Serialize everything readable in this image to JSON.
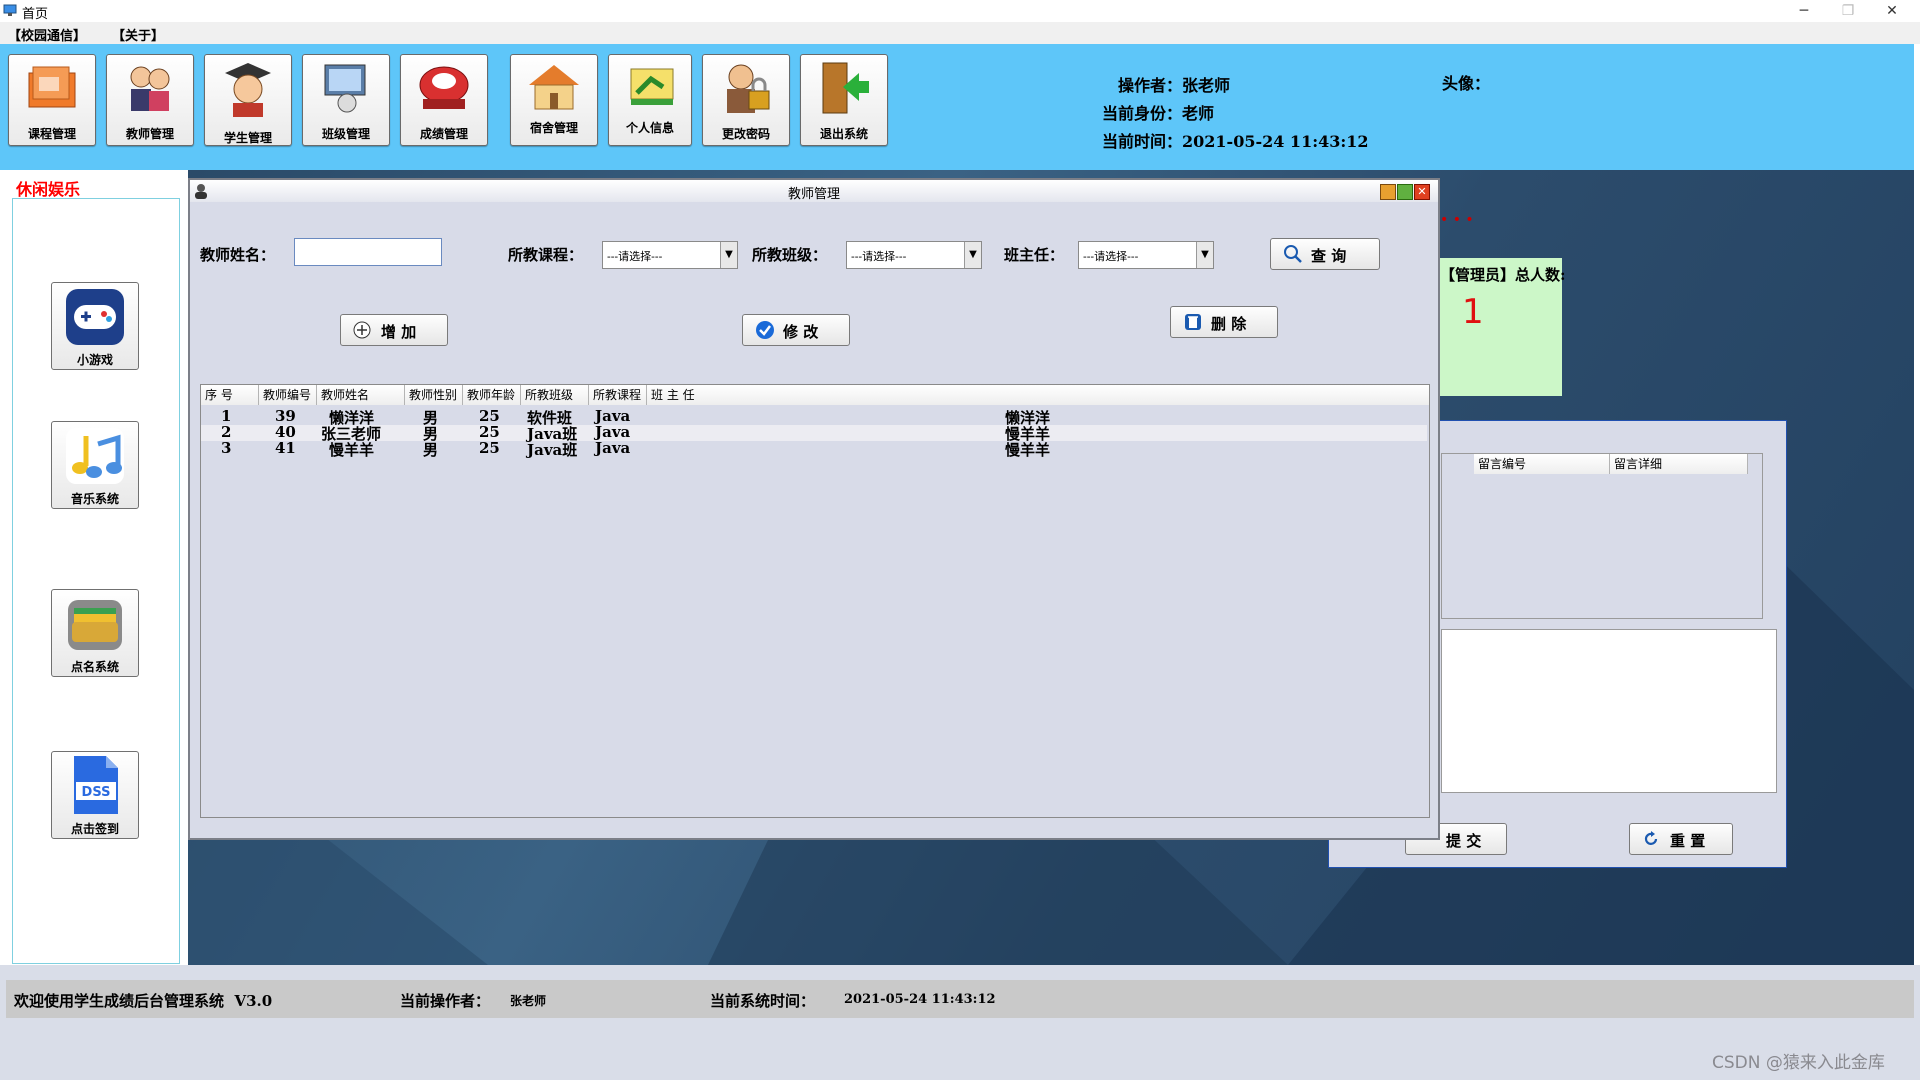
{
  "window": {
    "title": "首页",
    "minimize": "─",
    "restore": "❐",
    "close": "✕"
  },
  "menu": {
    "items": [
      "【校园通信】",
      "【关于】"
    ]
  },
  "toolbar": {
    "buttons": [
      {
        "label": "课程管理",
        "icon": "folder-icon"
      },
      {
        "label": "教师管理",
        "icon": "teachers-icon"
      },
      {
        "label": "学生管理",
        "icon": "graduate-icon"
      },
      {
        "label": "班级管理",
        "icon": "computer-icon"
      },
      {
        "label": "成绩管理",
        "icon": "scale-icon"
      },
      {
        "label": "宿舍管理",
        "icon": "house-icon"
      },
      {
        "label": "个人信息",
        "icon": "profile-icon"
      },
      {
        "label": "更改密码",
        "icon": "lock-icon"
      },
      {
        "label": "退出系统",
        "icon": "exit-door-icon"
      }
    ]
  },
  "info": {
    "operator_label": "操作者：",
    "operator": "张老师",
    "role_label": "当前身份：",
    "role": "老师",
    "time_label": "当前时间：",
    "time": "2021-05-24 11:43:12",
    "avatar_label": "头像："
  },
  "sidebar": {
    "title": "休闲娱乐",
    "items": [
      {
        "label": "小游戏",
        "icon": "gamepad-icon"
      },
      {
        "label": "音乐系统",
        "icon": "music-note-icon"
      },
      {
        "label": "点名系统",
        "icon": "wallet-icon"
      },
      {
        "label": "点击签到",
        "icon": "dss-file-icon"
      }
    ]
  },
  "teacher_window": {
    "title": "教师管理",
    "name_label": "教师姓名：",
    "name_value": "",
    "course_label": "所教课程：",
    "course_value": "---请选择---",
    "class_label": "所教班级：",
    "class_value": "---请选择---",
    "head_label": "班主任：",
    "head_value": "---请选择---",
    "query_label": "查  询",
    "add_label": "增  加",
    "edit_label": "修  改",
    "delete_label": "删  除",
    "table": {
      "headers": [
        "序  号",
        "教师编号",
        "教师姓名",
        "教师性别",
        "教师年龄",
        "所教班级",
        "所教课程",
        "班 主 任"
      ],
      "rows": [
        [
          "1",
          "39",
          "懒洋洋",
          "男",
          "25",
          "软件班",
          "Java",
          "懒洋洋"
        ],
        [
          "2",
          "40",
          "张三老师",
          "男",
          "25",
          "Java班",
          "Java",
          "慢羊羊"
        ],
        [
          "3",
          "41",
          "慢羊羊",
          "男",
          "25",
          "Java班",
          "Java",
          "慢羊羊"
        ]
      ]
    }
  },
  "right_panel": {
    "admin_label": "【管理员】总人数:",
    "admin_count": "1",
    "msg_headers": [
      "留言编号",
      "留言详细"
    ],
    "submit_label": "提  交",
    "reset_label": "重  置"
  },
  "status": {
    "welcome": "欢迎使用学生成绩后台管理系统  V3.0",
    "operator_label": "当前操作者：",
    "operator": "张老师",
    "time_label": "当前系统时间：",
    "time": "2021-05-24 11:43:12"
  },
  "watermark": "CSDN @猿来入此金库",
  "colors": {
    "toolbar": "#5ec6f9",
    "accent_red": "#ff0000",
    "admin_green": "#ccf7c8"
  }
}
